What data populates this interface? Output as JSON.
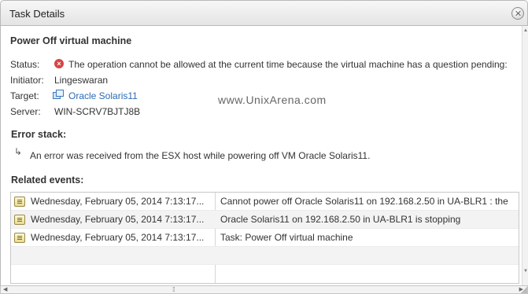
{
  "window": {
    "title": "Task Details"
  },
  "details": {
    "heading": "Power Off virtual machine",
    "status_label": "Status:",
    "status_value": "The operation cannot be allowed at the current time because the virtual machine has a question pending:",
    "initiator_label": "Initiator:",
    "initiator_value": "Lingeswaran",
    "target_label": "Target:",
    "target_value": "Oracle Solaris11",
    "server_label": "Server:",
    "server_value": "WIN-SCRV7BJTJ8B"
  },
  "watermark": "www.UnixArena.com",
  "error_stack": {
    "title": "Error stack:",
    "message": "An error was received from the ESX host while powering off VM Oracle Solaris11."
  },
  "related_events": {
    "title": "Related events:",
    "rows": [
      {
        "time": "Wednesday, February 05, 2014 7:13:17...",
        "description": "Cannot power off  Oracle Solaris11  on   192.168.2.50  in  UA-BLR1  : the"
      },
      {
        "time": "Wednesday, February 05, 2014 7:13:17...",
        "description": "Oracle Solaris11  on   192.168.2.50  in  UA-BLR1  is stopping"
      },
      {
        "time": "Wednesday, February 05, 2014 7:13:17...",
        "description": "Task: Power Off virtual machine"
      }
    ]
  },
  "icons": {
    "close": "close-icon",
    "status": "error-icon",
    "target": "vm-icon",
    "error_stack": "return-arrow-icon",
    "event": "event-icon"
  },
  "colors": {
    "error": "#d64545",
    "link": "#2a6ab5"
  }
}
